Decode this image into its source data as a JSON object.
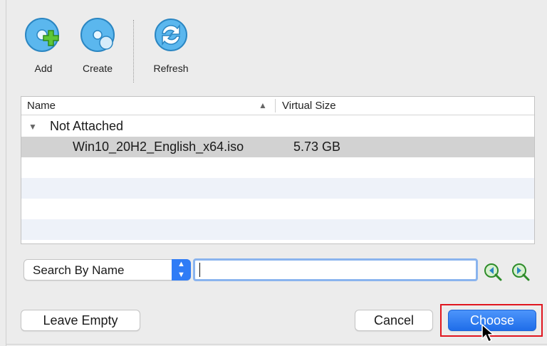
{
  "toolbar": {
    "add_label": "Add",
    "create_label": "Create",
    "refresh_label": "Refresh"
  },
  "list": {
    "columns": {
      "name": "Name",
      "size": "Virtual Size"
    },
    "group": "Not Attached",
    "items": [
      {
        "name": "Win10_20H2_English_x64.iso",
        "size": "5.73 GB"
      }
    ]
  },
  "search": {
    "mode": "Search By Name",
    "value": ""
  },
  "buttons": {
    "leave_empty": "Leave Empty",
    "cancel": "Cancel",
    "choose": "Choose"
  },
  "colors": {
    "accent": "#1f6de9",
    "highlight": "#e0161f",
    "selected_row": "#d2d2d2",
    "stripe_row": "#eef2f9"
  },
  "icons": {
    "add": "add-disk-icon",
    "create": "create-disk-icon",
    "refresh": "refresh-icon",
    "search_prev": "search-previous-icon",
    "search_next": "search-next-icon"
  }
}
